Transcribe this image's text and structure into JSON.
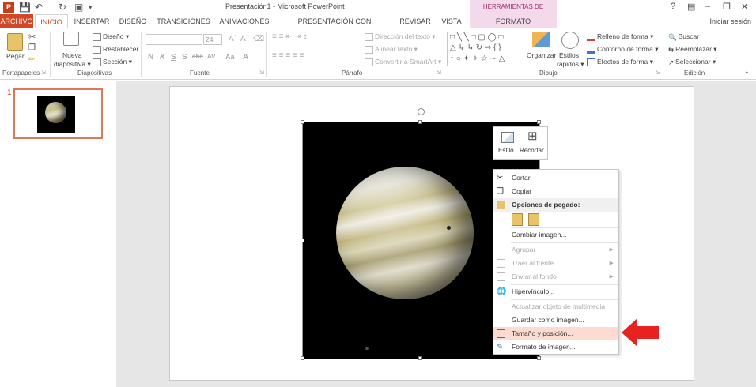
{
  "window": {
    "title": "Presentación1 - Microsoft PowerPoint",
    "contextual_group": "HERRAMIENTAS DE IMAGEN",
    "help": "?",
    "minimize": "–",
    "restore": "❐",
    "close": "✕",
    "sign_in": "Iniciar sesión"
  },
  "tabs": [
    "ARCHIVO",
    "INICIO",
    "INSERTAR",
    "DISEÑO",
    "TRANSICIONES",
    "ANIMACIONES",
    "PRESENTACIÓN CON DIAPOSITIVAS",
    "REVISAR",
    "VISTA",
    "FORMATO"
  ],
  "ribbon": {
    "portapapeles": {
      "label": "Portapapeles",
      "paste": "Pegar"
    },
    "diapositivas": {
      "label": "Diapositivas",
      "new_slide": "Nueva",
      "new_slide_2": "diapositiva ▾",
      "design": "Diseño ▾",
      "reset": "Restablecer",
      "section": "Sección ▾"
    },
    "fuente": {
      "label": "Fuente",
      "size": "24",
      "bold": "N",
      "italic": "K",
      "underline": "S",
      "strike": "S",
      "spacing": "abc",
      "aa": "AV",
      "case": "Aa",
      "color": "A"
    },
    "parrafo": {
      "label": "Párrafo",
      "text_direction": "Dirección del texto ▾",
      "align_text": "Alinear texto ▾",
      "smartart": "Convertir a SmartArt ▾"
    },
    "dibujo": {
      "label": "Dibujo",
      "arrange": "Organizar",
      "quick_styles": "Estilos",
      "quick_styles_2": "rápidos ▾",
      "fill": "Relleno de forma ▾",
      "outline": "Contorno de forma ▾",
      "effects": "Efectos de forma ▾"
    },
    "edicion": {
      "label": "Edición",
      "find": "Buscar",
      "replace": "Reemplazar ▾",
      "select": "Seleccionar ▾"
    }
  },
  "slides_pane": {
    "slide_number": "1"
  },
  "mini_toolbar": {
    "style": "Estilo",
    "crop": "Recortar"
  },
  "context_menu": [
    {
      "label": "Cortar",
      "icon": "scissors-icon",
      "enabled": true
    },
    {
      "label": "Copiar",
      "icon": "copy-icon",
      "enabled": true
    },
    {
      "label": "Opciones de pegado:",
      "icon": "paste-icon",
      "enabled": true,
      "header": true
    },
    {
      "label": "Cambiar imagen...",
      "icon": "change-picture-icon",
      "enabled": true
    },
    {
      "label": "Agrupar",
      "icon": "group-icon",
      "enabled": false,
      "submenu": true
    },
    {
      "label": "Traer al frente",
      "icon": "bring-front-icon",
      "enabled": false,
      "submenu": true
    },
    {
      "label": "Enviar al fondo",
      "icon": "send-back-icon",
      "enabled": false,
      "submenu": true
    },
    {
      "label": "Hipervínculo...",
      "icon": "hyperlink-icon",
      "enabled": true
    },
    {
      "label": "Actualizar objeto de multimedia",
      "icon": "",
      "enabled": false
    },
    {
      "label": "Guardar como imagen...",
      "icon": "",
      "enabled": true
    },
    {
      "label": "Tamaño y posición...",
      "icon": "size-position-icon",
      "enabled": true,
      "highlighted": true
    },
    {
      "label": "Formato de imagen...",
      "icon": "format-picture-icon",
      "enabled": true
    }
  ],
  "colors": {
    "accent": "#d24726",
    "contextual": "#f3d9e9",
    "highlight": "#fbdbd2",
    "arrow": "#e8231f"
  }
}
